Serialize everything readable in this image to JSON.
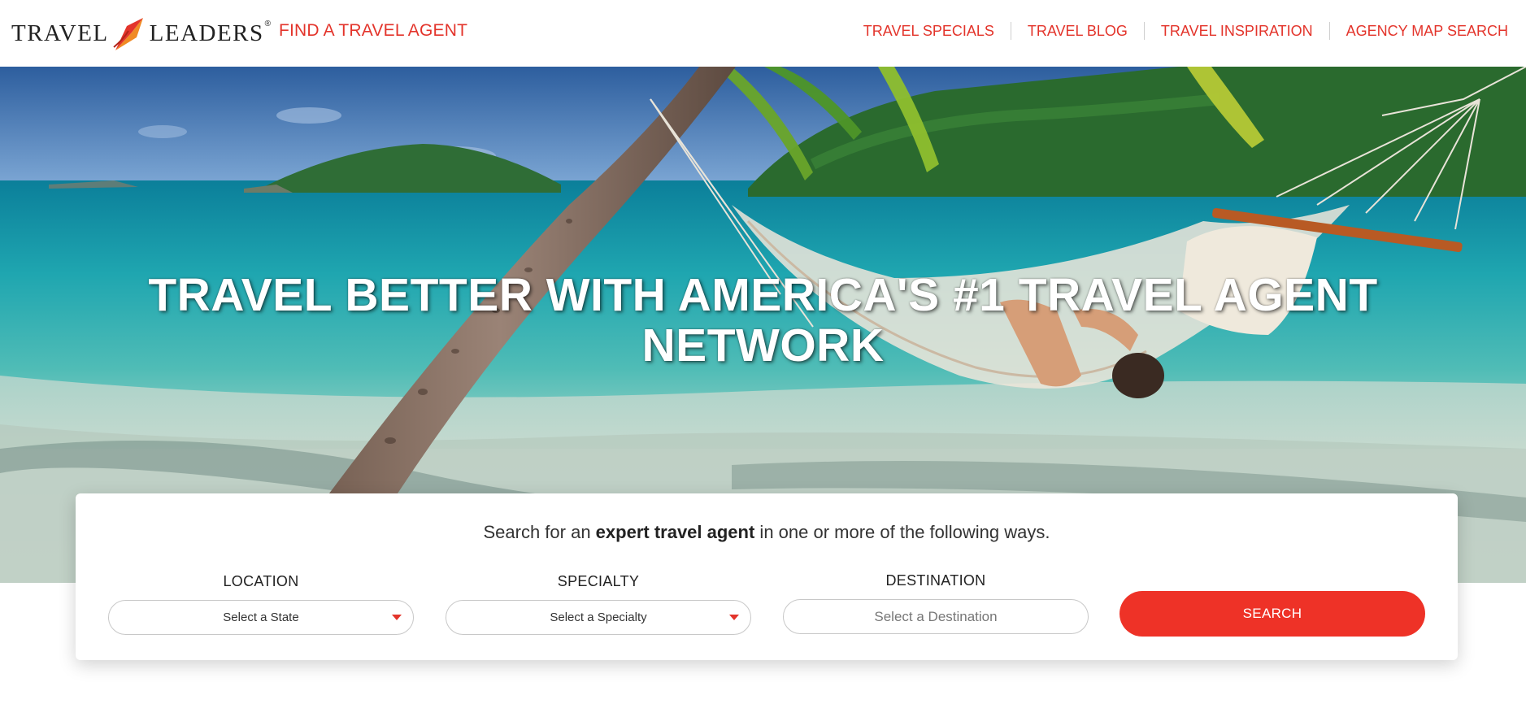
{
  "header": {
    "logo": {
      "left_word": "TRAVEL",
      "right_word": "LEADERS",
      "reg_mark": "®",
      "icon": "arrow-swoosh-icon"
    },
    "find_agent_label": "FIND A TRAVEL AGENT",
    "nav": [
      "TRAVEL SPECIALS",
      "TRAVEL BLOG",
      "TRAVEL INSPIRATION",
      "AGENCY MAP SEARCH"
    ]
  },
  "hero": {
    "title": "TRAVEL BETTER WITH AMERICA'S #1 TRAVEL AGENT NETWORK",
    "image": "beach-hammock-palm-image"
  },
  "search": {
    "intro_before": "Search for an ",
    "intro_bold": "expert travel agent",
    "intro_after": " in one or more of the following ways.",
    "location": {
      "label": "LOCATION",
      "value": "Select a State"
    },
    "specialty": {
      "label": "SPECIALTY",
      "value": "Select a Specialty"
    },
    "destination": {
      "label": "DESTINATION",
      "placeholder": "Select a Destination"
    },
    "button_label": "SEARCH"
  },
  "colors": {
    "accent": "#e3342b",
    "button": "#ee3227",
    "caret": "#e3342b"
  }
}
